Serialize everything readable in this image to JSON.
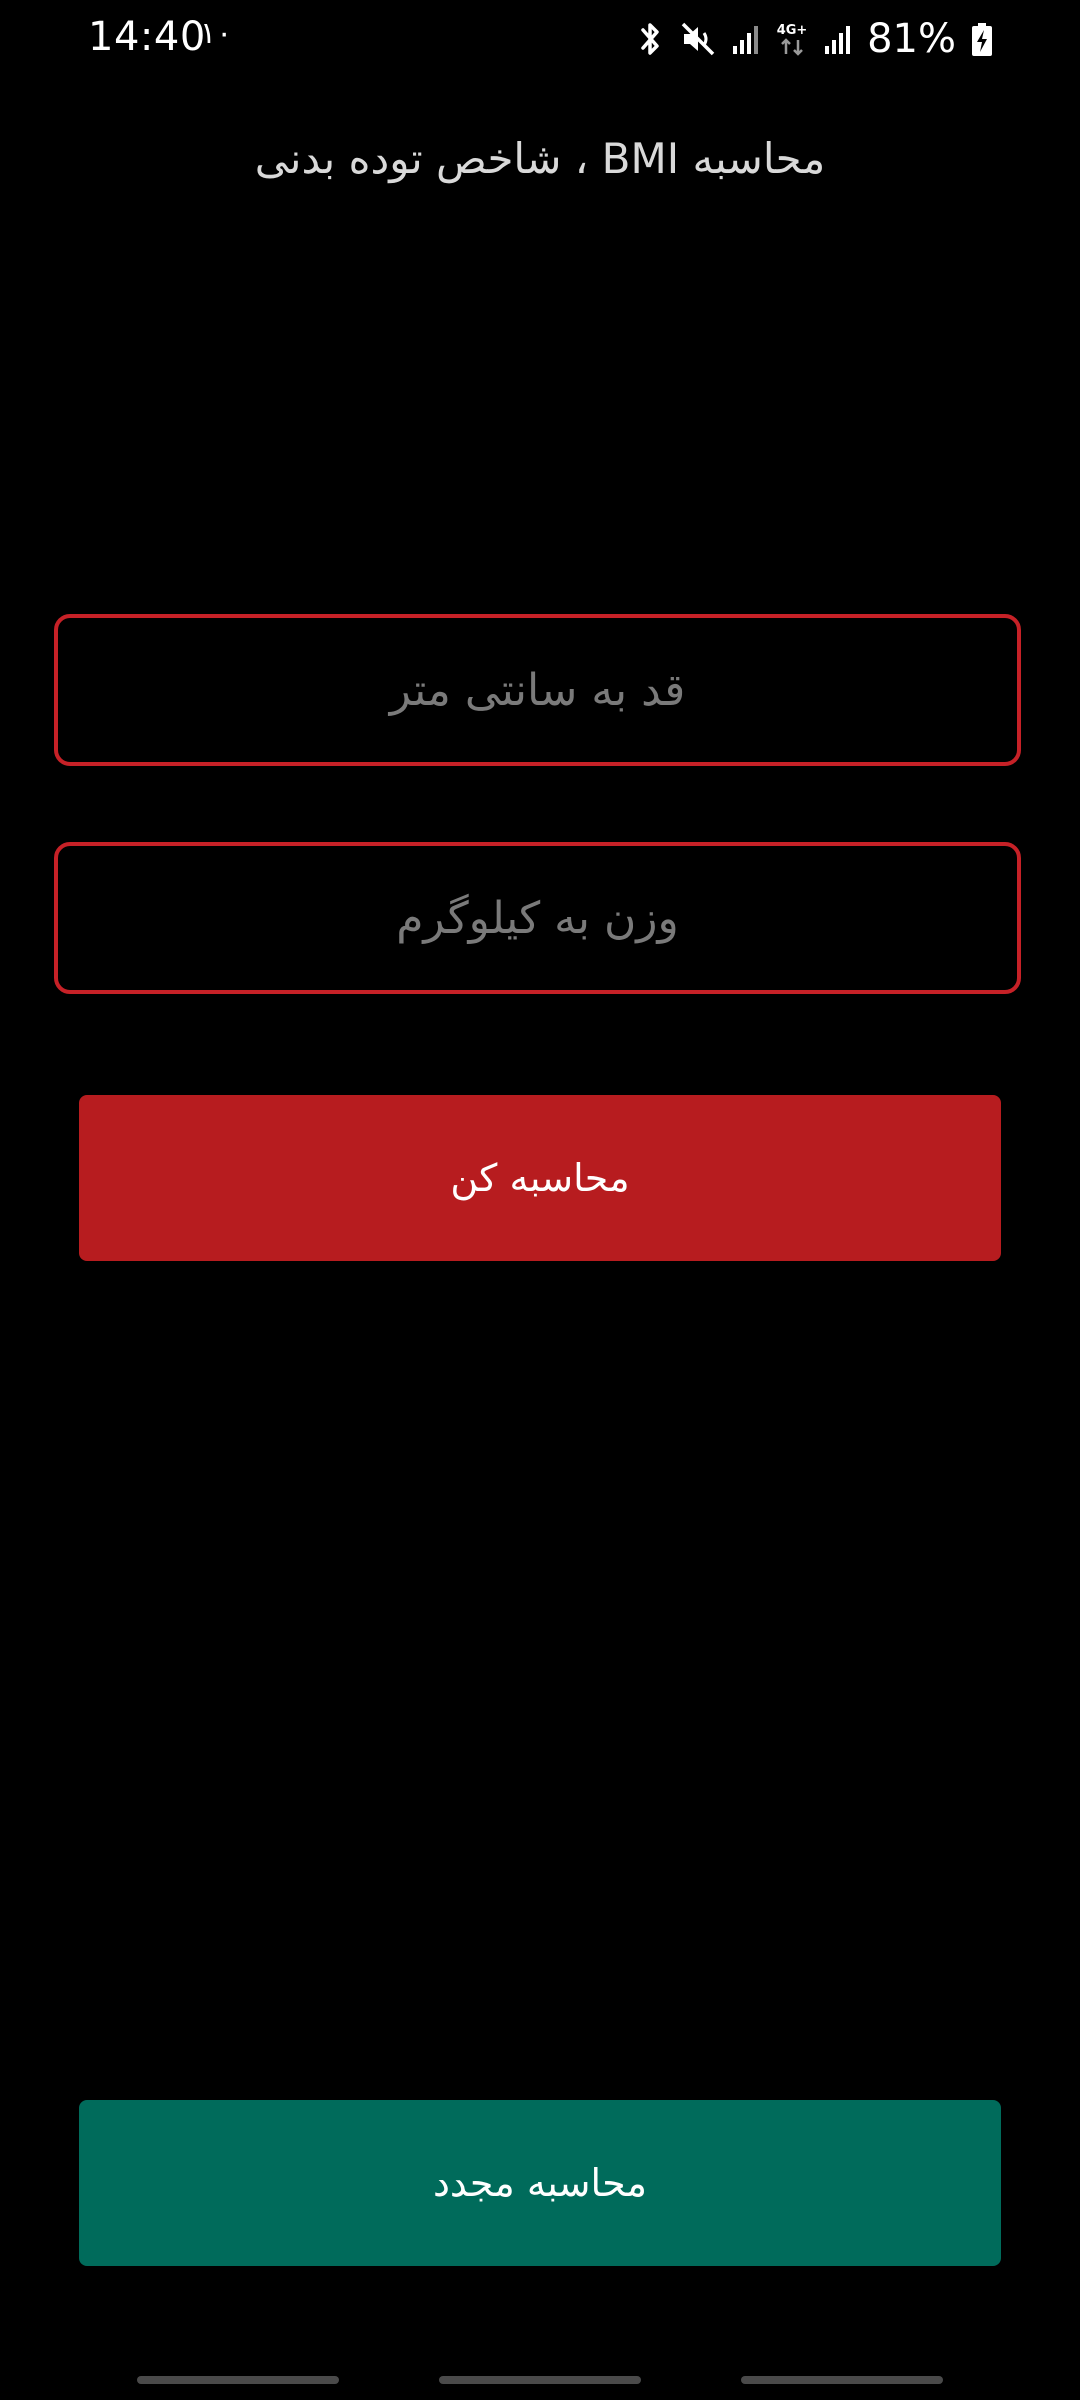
{
  "status_bar": {
    "time": "14:40",
    "notification": "۱۰",
    "battery_percent": "81%",
    "network_type": "4G+",
    "icons": [
      "bluetooth-icon",
      "mute-vibrate-icon",
      "signal-icon",
      "data-icon",
      "signal-icon",
      "battery-charging-icon"
    ]
  },
  "app": {
    "title": "محاسبه BMI ، شاخص توده بدنی"
  },
  "form": {
    "height_placeholder": "قد به سانتی متر",
    "height_value": "",
    "weight_placeholder": "وزن به کیلوگرم",
    "weight_value": ""
  },
  "buttons": {
    "calculate_label": "محاسبه کن",
    "reset_label": "محاسبه مجدد"
  },
  "colors": {
    "background": "#000000",
    "field_border": "#c62127",
    "calculate_button": "#b71c1f",
    "reset_button": "#006b5b",
    "placeholder": "#7a7a7a"
  }
}
